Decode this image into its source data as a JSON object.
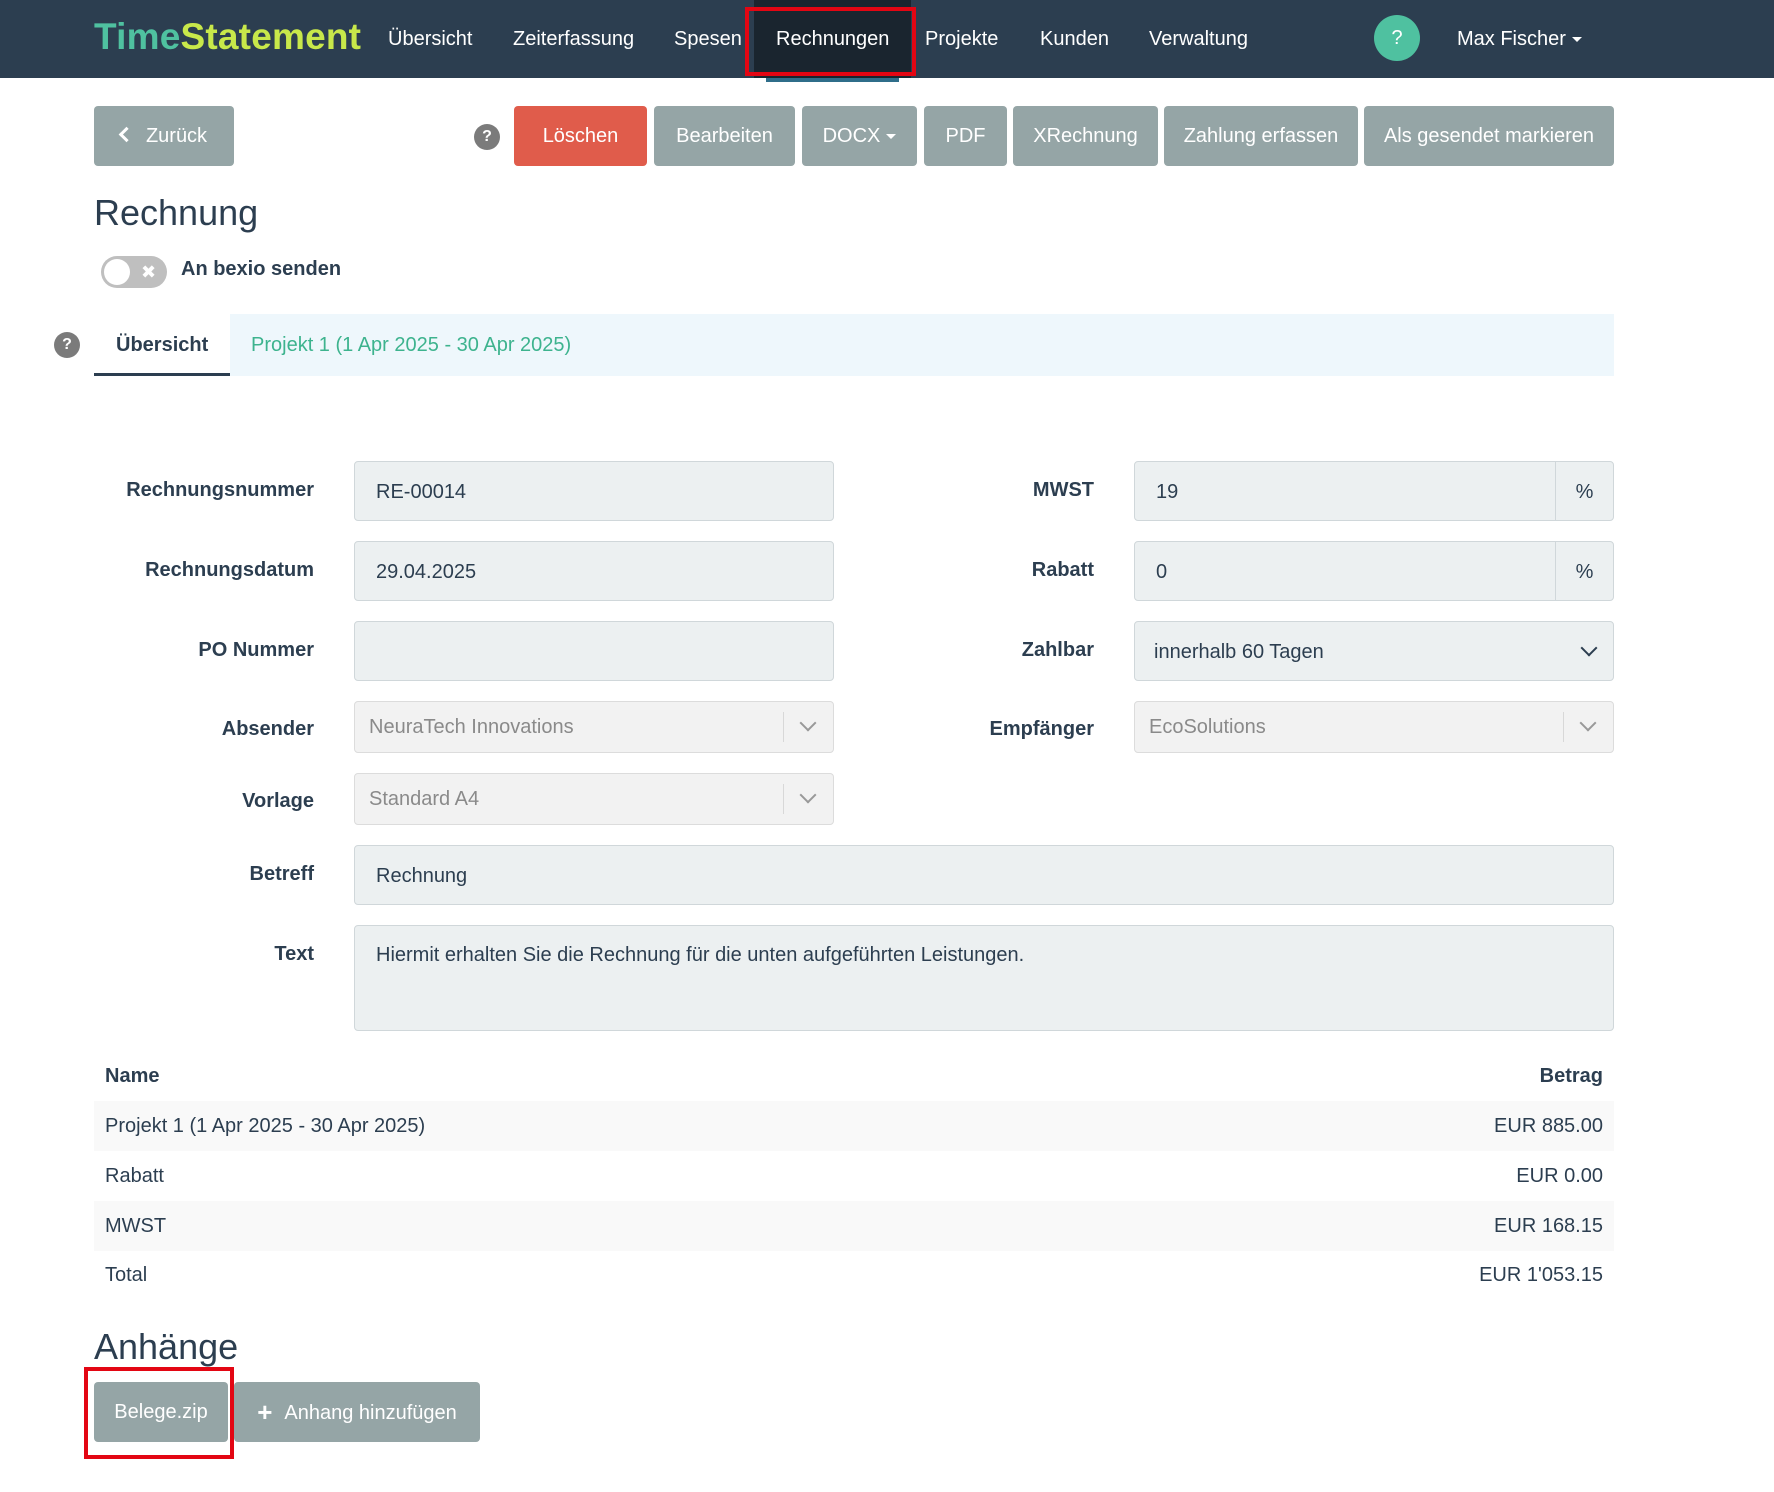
{
  "brand": {
    "part1": "Time",
    "part2": "Statement"
  },
  "nav": {
    "items": [
      "Übersicht",
      "Zeiterfassung",
      "Spesen",
      "Rechnungen",
      "Projekte",
      "Kunden",
      "Verwaltung"
    ],
    "help": "?",
    "user": "Max Fischer"
  },
  "toolbar": {
    "back": "Zurück",
    "help": "?",
    "delete": "Löschen",
    "edit": "Bearbeiten",
    "docx": "DOCX",
    "pdf": "PDF",
    "xrechnung": "XRechnung",
    "payment": "Zahlung erfassen",
    "mark_sent": "Als gesendet markieren"
  },
  "page": {
    "title": "Rechnung",
    "toggle_label": "An bexio senden",
    "toggle_off_symbol": "✖"
  },
  "tabs": {
    "help": "?",
    "overview": "Übersicht",
    "project": "Projekt 1 (1 Apr 2025 - 30 Apr 2025)"
  },
  "form": {
    "invoice_number": {
      "label": "Rechnungsnummer",
      "value": "RE-00014"
    },
    "invoice_date": {
      "label": "Rechnungsdatum",
      "value": "29.04.2025"
    },
    "po_number": {
      "label": "PO Nummer",
      "value": ""
    },
    "sender": {
      "label": "Absender",
      "value": "NeuraTech Innovations"
    },
    "template": {
      "label": "Vorlage",
      "value": "Standard A4"
    },
    "subject": {
      "label": "Betreff",
      "value": "Rechnung"
    },
    "text": {
      "label": "Text",
      "value": "Hiermit erhalten Sie die Rechnung für die unten aufgeführten Leistungen."
    },
    "vat": {
      "label": "MWST",
      "value": "19",
      "unit": "%"
    },
    "discount": {
      "label": "Rabatt",
      "value": "0",
      "unit": "%"
    },
    "payable": {
      "label": "Zahlbar",
      "value": "innerhalb 60 Tagen"
    },
    "recipient": {
      "label": "Empfänger",
      "value": "EcoSolutions"
    }
  },
  "table": {
    "headers": {
      "name": "Name",
      "amount": "Betrag"
    },
    "rows": [
      {
        "name": "Projekt 1 (1 Apr 2025 - 30 Apr 2025)",
        "amount": "EUR 885.00"
      },
      {
        "name": "Rabatt",
        "amount": "EUR 0.00"
      },
      {
        "name": "MWST",
        "amount": "EUR 168.15"
      },
      {
        "name": "Total",
        "amount": "EUR 1'053.15"
      }
    ]
  },
  "attachments": {
    "title": "Anhänge",
    "file": "Belege.zip",
    "add_icon": "+",
    "add": "Anhang hinzufügen"
  },
  "colors": {
    "navbar": "#2c3e50",
    "brand_time": "#4fc1a0",
    "brand_statement": "#c8e84a",
    "danger": "#e05c4b",
    "button_default": "#95a5a6",
    "tab_link": "#3db38e",
    "annotation_box": "#e30613"
  }
}
